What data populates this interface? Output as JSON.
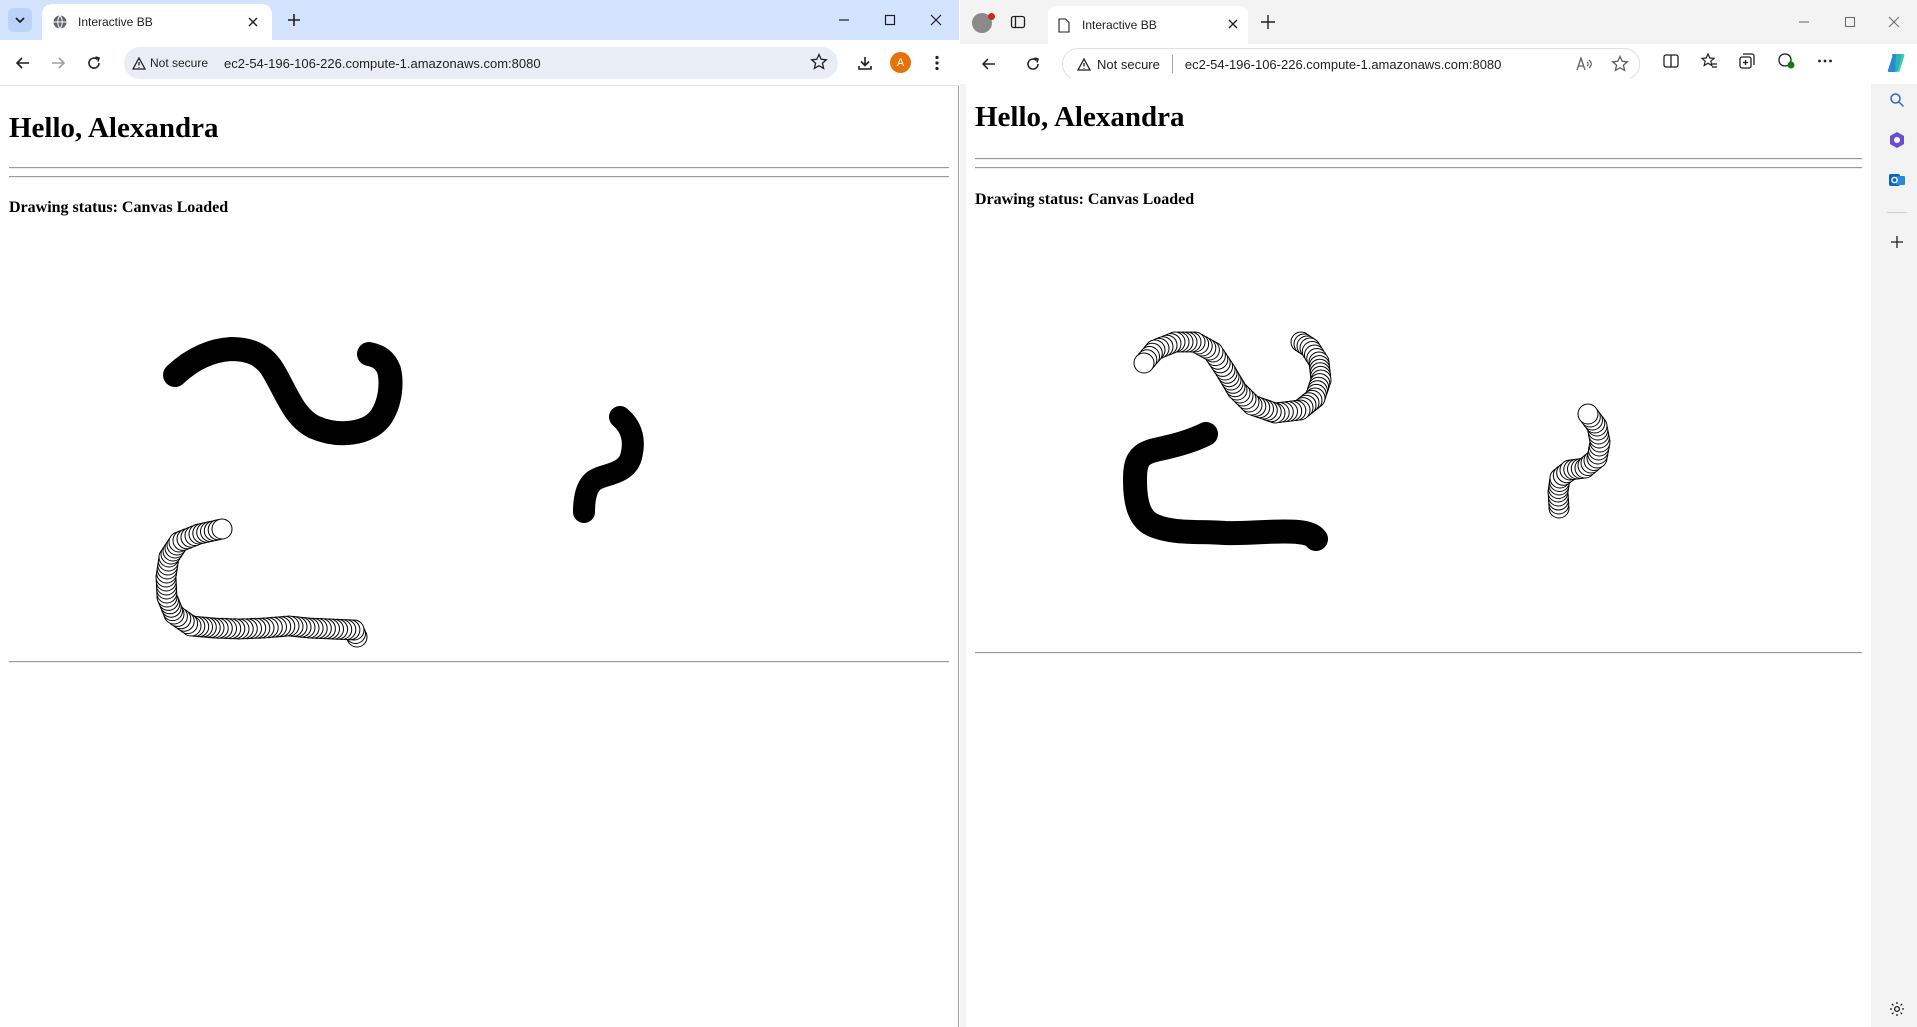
{
  "left_browser": {
    "tab_title": "Interactive BB",
    "security_label": "Not secure",
    "url": "ec2-54-196-106-226.compute-1.amazonaws.com:8080",
    "profile_initial": "A"
  },
  "right_browser": {
    "tab_title": "Interactive BB",
    "security_label": "Not secure",
    "url": "ec2-54-196-106-226.compute-1.amazonaws.com:8080"
  },
  "page": {
    "greeting": "Hello, Alexandra",
    "status_label": "Drawing status: Canvas Loaded"
  },
  "colors": {
    "chrome_tabstrip": "#d3e3fd",
    "edge_frame": "#f3f3f3",
    "stroke_black": "#000000",
    "avatar_orange": "#e8710a"
  }
}
